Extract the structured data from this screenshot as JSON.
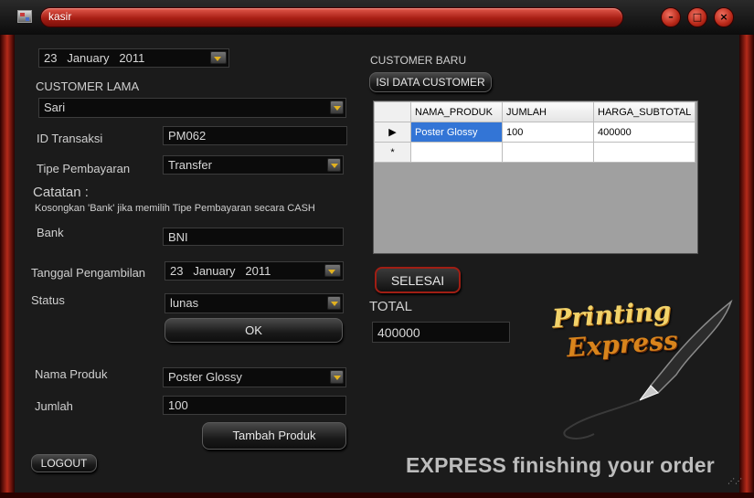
{
  "window": {
    "title": "kasir",
    "minimize_icon": "minimize-icon",
    "maximize_icon": "maximize-icon",
    "close_icon": "close-icon"
  },
  "left": {
    "order_date": {
      "day": "23",
      "month": "January",
      "year": "2011"
    },
    "customer_lama_label": "CUSTOMER LAMA",
    "customer_lama_value": "Sari",
    "id_transaksi_label": "ID Transaksi",
    "id_transaksi_value": "PM062",
    "tipe_pembayaran_label": "Tipe Pembayaran",
    "tipe_pembayaran_value": "Transfer",
    "catatan_label": "Catatan :",
    "catatan_note": "Kosongkan 'Bank' jika memilih Tipe Pembayaran secara CASH",
    "bank_label": "Bank",
    "bank_value": "BNI",
    "tanggal_label": "Tanggal Pengambilan",
    "tanggal_value": {
      "day": "23",
      "month": "January",
      "year": "2011"
    },
    "status_label": "Status",
    "status_value": "lunas",
    "ok_label": "OK",
    "nama_produk_label": "Nama Produk",
    "nama_produk_value": "Poster Glossy",
    "jumlah_label": "Jumlah",
    "jumlah_value": "100",
    "tambah_label": "Tambah Produk",
    "logout_label": "LOGOUT"
  },
  "right": {
    "customer_baru_label": "CUSTOMER BARU",
    "isi_data_label": "ISI DATA CUSTOMER",
    "grid": {
      "columns": [
        "NAMA_PRODUK",
        "JUMLAH",
        "HARGA_SUBTOTAL"
      ],
      "rows": [
        [
          "Poster Glossy",
          "100",
          "400000"
        ]
      ],
      "new_row_marker": "*"
    },
    "selesai_label": "SELESAI",
    "total_label": "TOTAL",
    "total_value": "400000"
  },
  "branding": {
    "logo_line1": "Printing",
    "logo_line2": "Express",
    "tagline": "EXPRESS finishing your order"
  },
  "colors": {
    "accent_red": "#b52a1a",
    "selection_blue": "#3375d6",
    "logo_gold": "#f2d36a",
    "logo_orange": "#d8841c"
  }
}
